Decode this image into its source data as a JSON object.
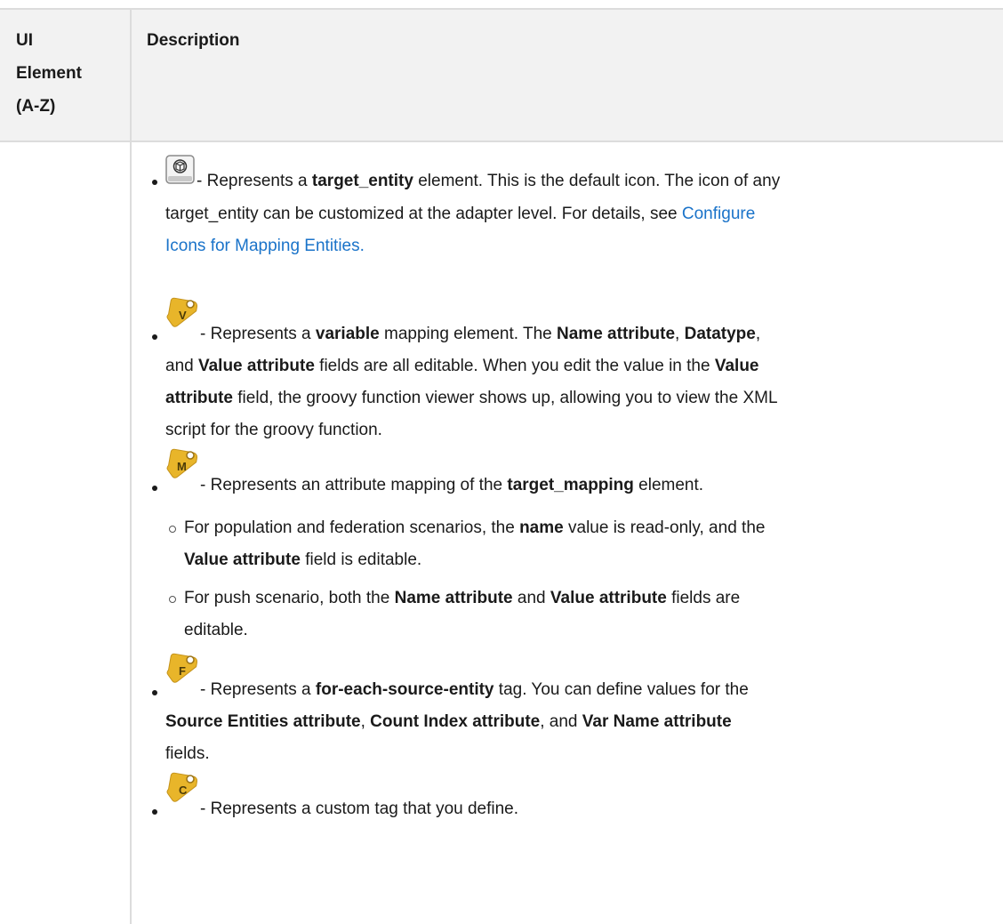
{
  "header": {
    "col1": [
      "UI",
      "Element",
      "(A-Z)"
    ],
    "col2": "Description"
  },
  "items": {
    "target_entity": {
      "icon": "cube-icon",
      "pre": " - Represents a ",
      "bold": "target_entity",
      "post": " element. This is the default icon. The icon of any",
      "line2": "target_entity can be customized at the adapter level. For details, see ",
      "link1": "Configure",
      "link2": "Icons for Mapping Entities."
    },
    "variable": {
      "letter": "V",
      "l1_a": " - Represents a ",
      "l1_b": "variable",
      "l1_c": " mapping element. The ",
      "l1_d": "Name attribute",
      "l1_e": ", ",
      "l1_f": "Datatype",
      "l1_g": ",",
      "l2_a": "and ",
      "l2_b": "Value attribute",
      "l2_c": " fields are all editable. When you edit the value in the ",
      "l2_d": "Value",
      "l3_a": "attribute",
      "l3_b": " field, the groovy function viewer shows up, allowing you to view the XML",
      "l4": "script for the groovy function."
    },
    "mapping": {
      "letter": "M",
      "a": " - Represents an attribute mapping of the ",
      "b": "target_mapping",
      "c": " element.",
      "sub1_l1_a": "For population and federation scenarios, the ",
      "sub1_l1_b": "name",
      "sub1_l1_c": " value is read-only, and the",
      "sub1_l2_a": "Value attribute",
      "sub1_l2_b": " field is editable.",
      "sub2_l1_a": "For push scenario, both the ",
      "sub2_l1_b": "Name attribute",
      "sub2_l1_c": " and ",
      "sub2_l1_d": "Value attribute",
      "sub2_l1_e": " fields are",
      "sub2_l2": "editable."
    },
    "foreach": {
      "letter": "F",
      "l1_a": " - Represents a ",
      "l1_b": "for-each-source-entity",
      "l1_c": " tag. You can define values for the",
      "l2_a": "Source Entities attribute",
      "l2_b": ", ",
      "l2_c": "Count Index attribute",
      "l2_d": ", and ",
      "l2_e": "Var Name attribute",
      "l3": "fields."
    },
    "custom": {
      "letter": "C",
      "text": " - Represents a custom tag that you define."
    }
  },
  "colors": {
    "tag_gold": "#e8b52a",
    "link": "#1a73c9",
    "header_bg": "#f2f2f2"
  }
}
